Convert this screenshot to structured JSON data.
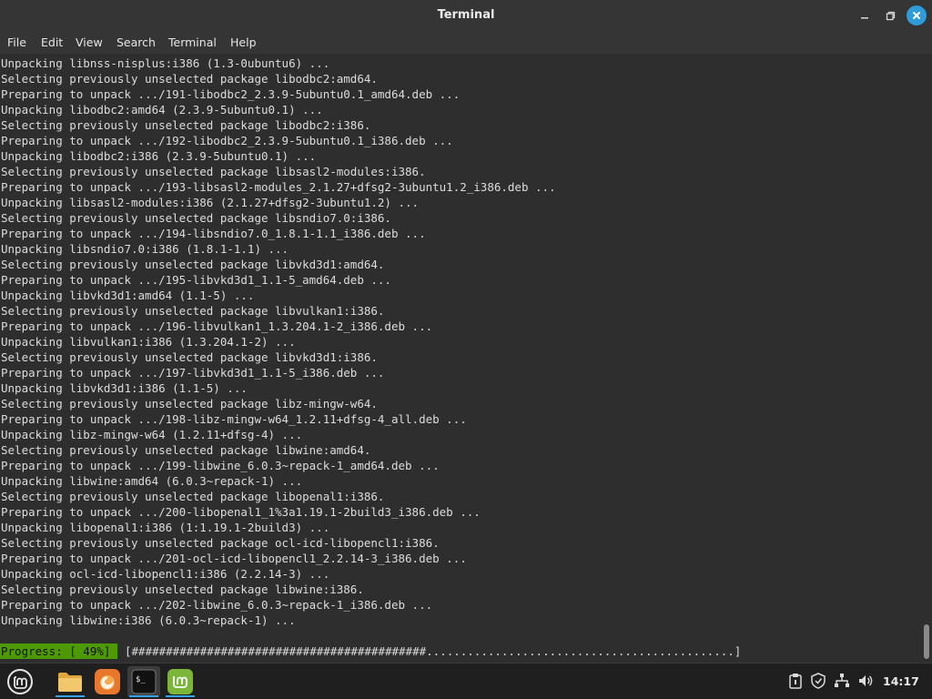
{
  "window": {
    "title": "Terminal"
  },
  "menu": [
    "File",
    "Edit",
    "View",
    "Search",
    "Terminal",
    "Help"
  ],
  "terminal": {
    "lines": [
      "Unpacking libnss-nisplus:i386 (1.3-0ubuntu6) ...",
      "Selecting previously unselected package libodbc2:amd64.",
      "Preparing to unpack .../191-libodbc2_2.3.9-5ubuntu0.1_amd64.deb ...",
      "Unpacking libodbc2:amd64 (2.3.9-5ubuntu0.1) ...",
      "Selecting previously unselected package libodbc2:i386.",
      "Preparing to unpack .../192-libodbc2_2.3.9-5ubuntu0.1_i386.deb ...",
      "Unpacking libodbc2:i386 (2.3.9-5ubuntu0.1) ...",
      "Selecting previously unselected package libsasl2-modules:i386.",
      "Preparing to unpack .../193-libsasl2-modules_2.1.27+dfsg2-3ubuntu1.2_i386.deb ...",
      "Unpacking libsasl2-modules:i386 (2.1.27+dfsg2-3ubuntu1.2) ...",
      "Selecting previously unselected package libsndio7.0:i386.",
      "Preparing to unpack .../194-libsndio7.0_1.8.1-1.1_i386.deb ...",
      "Unpacking libsndio7.0:i386 (1.8.1-1.1) ...",
      "Selecting previously unselected package libvkd3d1:amd64.",
      "Preparing to unpack .../195-libvkd3d1_1.1-5_amd64.deb ...",
      "Unpacking libvkd3d1:amd64 (1.1-5) ...",
      "Selecting previously unselected package libvulkan1:i386.",
      "Preparing to unpack .../196-libvulkan1_1.3.204.1-2_i386.deb ...",
      "Unpacking libvulkan1:i386 (1.3.204.1-2) ...",
      "Selecting previously unselected package libvkd3d1:i386.",
      "Preparing to unpack .../197-libvkd3d1_1.1-5_i386.deb ...",
      "Unpacking libvkd3d1:i386 (1.1-5) ...",
      "Selecting previously unselected package libz-mingw-w64.",
      "Preparing to unpack .../198-libz-mingw-w64_1.2.11+dfsg-4_all.deb ...",
      "Unpacking libz-mingw-w64 (1.2.11+dfsg-4) ...",
      "Selecting previously unselected package libwine:amd64.",
      "Preparing to unpack .../199-libwine_6.0.3~repack-1_amd64.deb ...",
      "Unpacking libwine:amd64 (6.0.3~repack-1) ...",
      "Selecting previously unselected package libopenal1:i386.",
      "Preparing to unpack .../200-libopenal1_1%3a1.19.1-2build3_i386.deb ...",
      "Unpacking libopenal1:i386 (1:1.19.1-2build3) ...",
      "Selecting previously unselected package ocl-icd-libopencl1:i386.",
      "Preparing to unpack .../201-ocl-icd-libopencl1_2.2.14-3_i386.deb ...",
      "Unpacking ocl-icd-libopencl1:i386 (2.2.14-3) ...",
      "Selecting previously unselected package libwine:i386.",
      "Preparing to unpack .../202-libwine_6.0.3~repack-1_i386.deb ...",
      "Unpacking libwine:i386 (6.0.3~repack-1) ..."
    ],
    "progress_label": "Progress: [ 49%]",
    "progress_bar": "[###########################################.............................................]",
    "progress_percent": 49
  },
  "taskbar": {
    "apps": [
      "mint-menu-icon",
      "files-folder-icon",
      "firefox-icon",
      "terminal-icon",
      "mint-update-manager-icon"
    ],
    "tray": [
      "clipboard-icon",
      "shield-icon",
      "network-icon",
      "volume-icon"
    ],
    "clock": "14:17"
  },
  "colors": {
    "progress_bg": "#4e9a06",
    "close_button": "#2f9bd8",
    "taskbar_indicator": "#35a3e8"
  }
}
